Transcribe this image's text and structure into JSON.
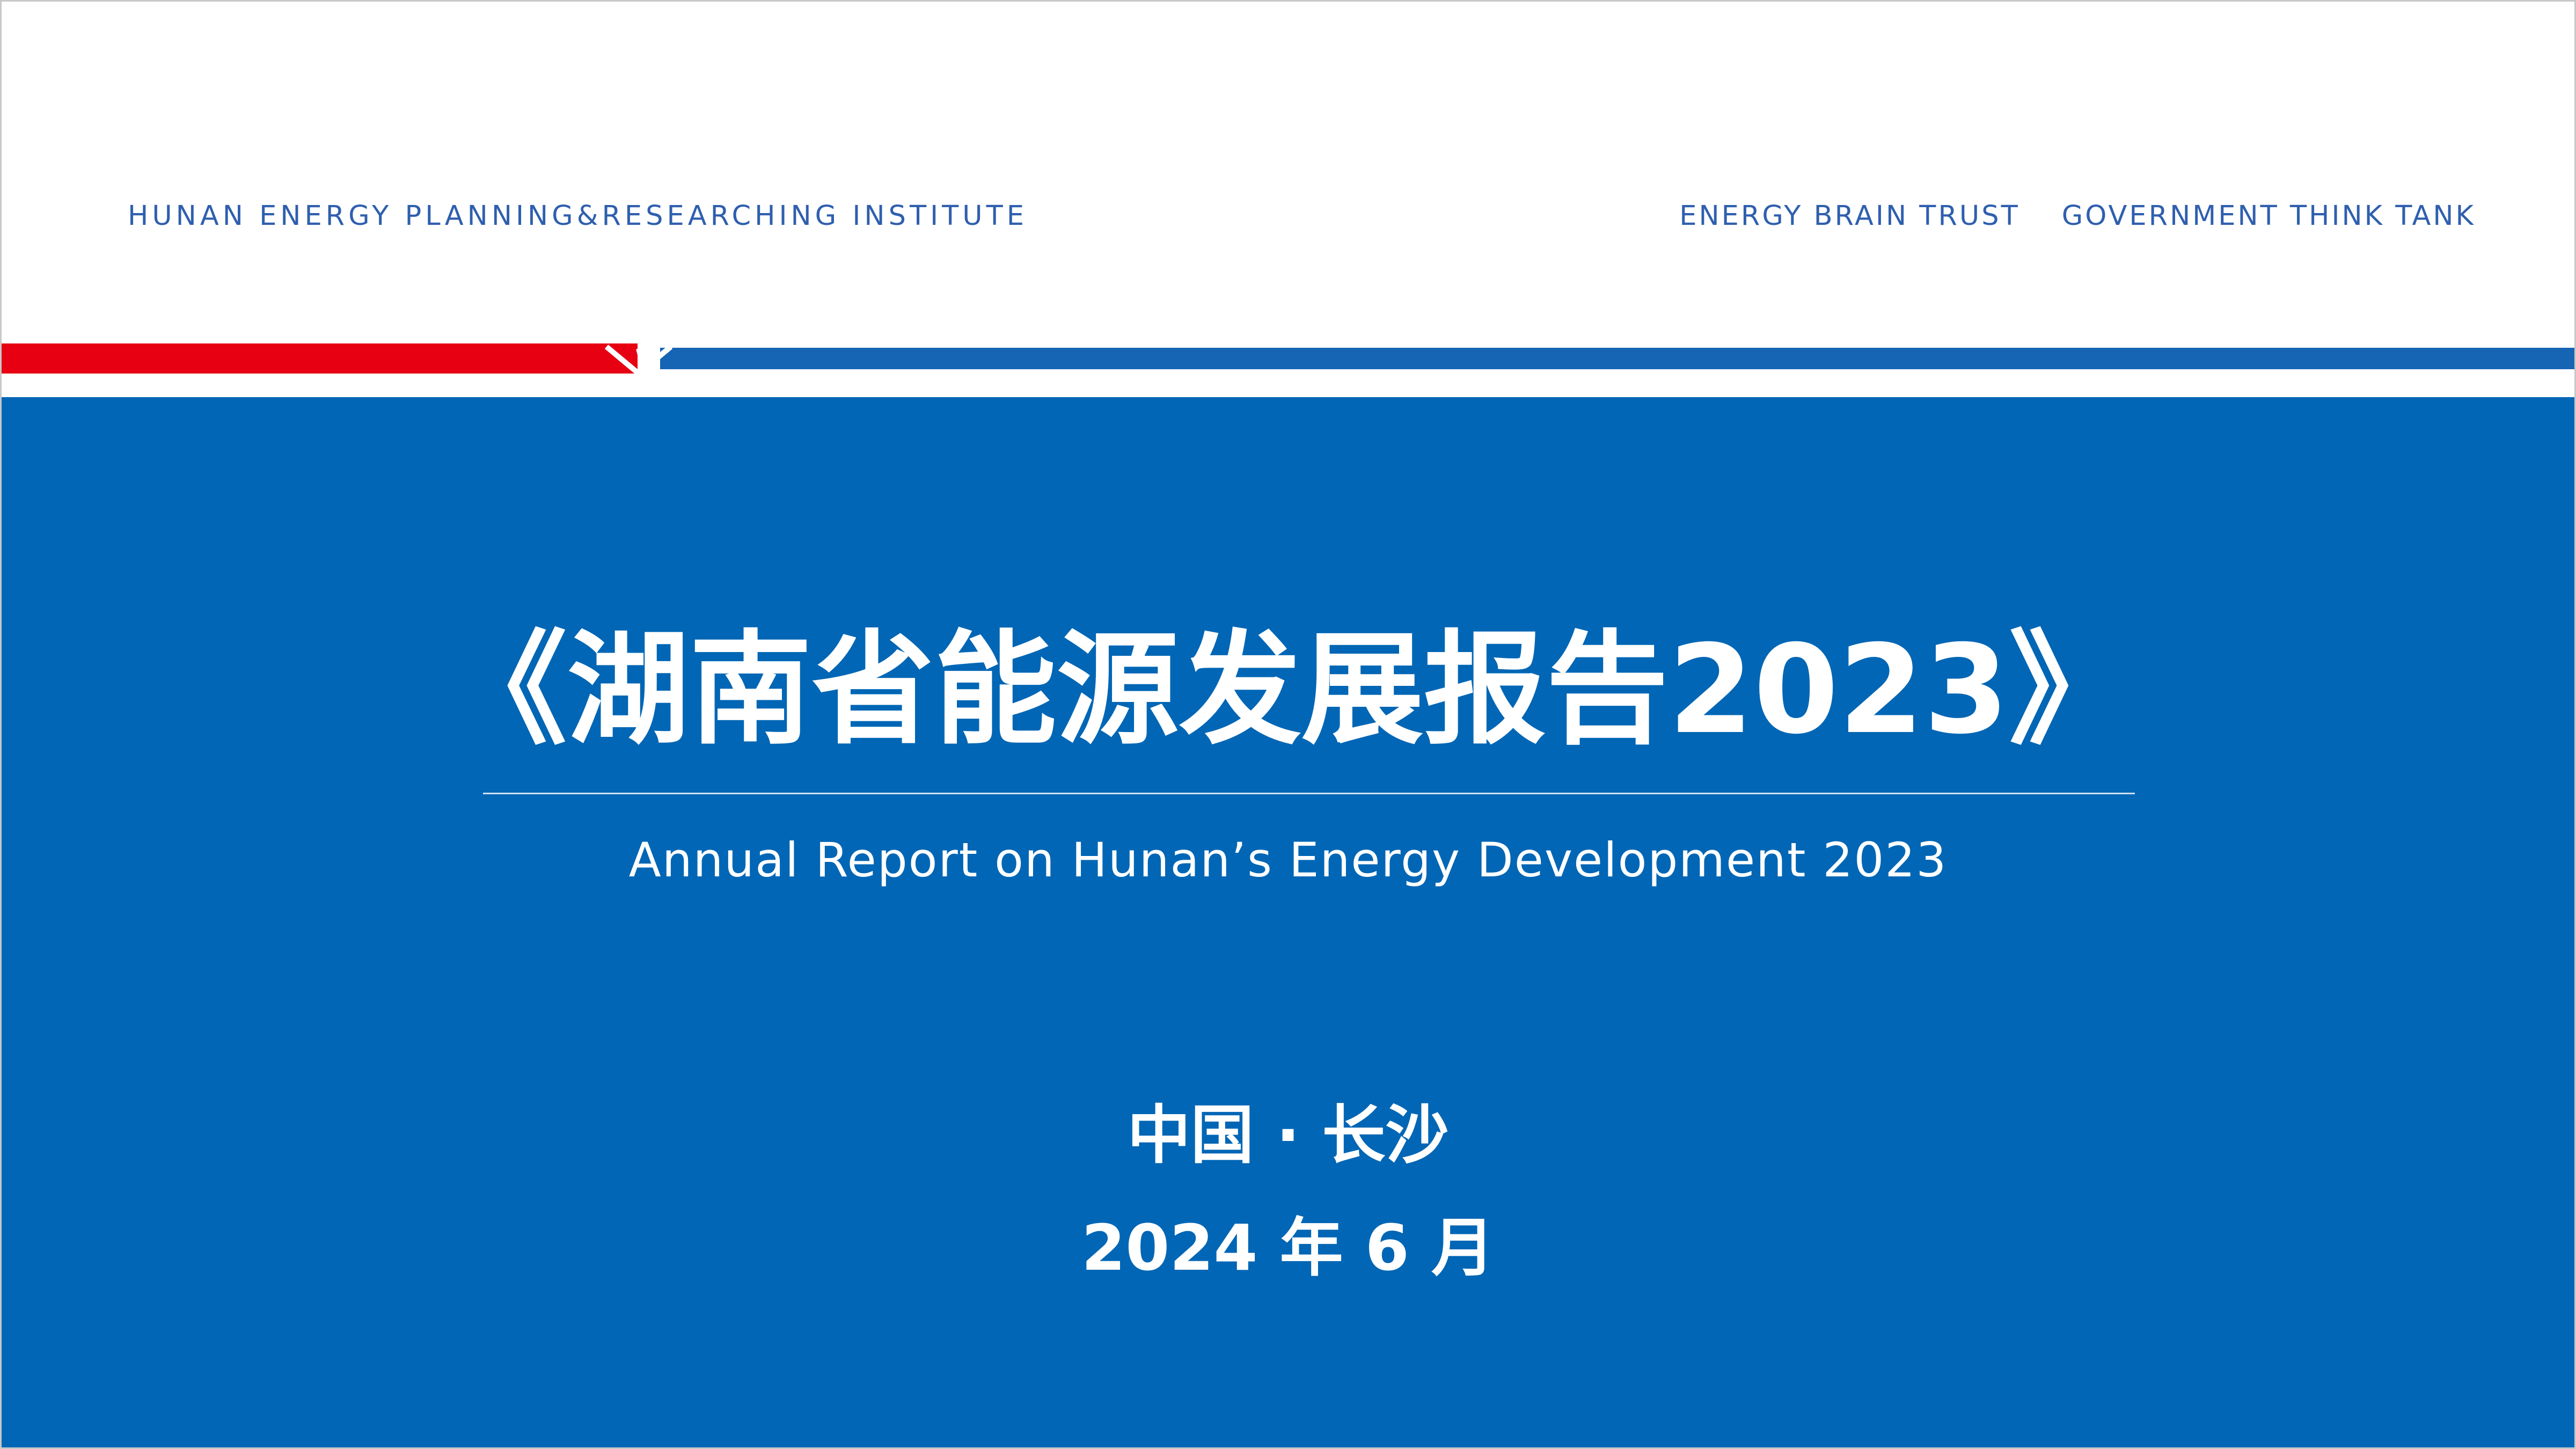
{
  "header": {
    "institute": "HUNAN ENERGY PLANNING&RESEARCHING INSTITUTE",
    "tag_1": "ENERGY BRAIN TRUST",
    "tag_2": "GOVERNMENT THINK TANK"
  },
  "cover": {
    "title_cn": "《湖南省能源发展报告2023》",
    "title_en": "Annual Report on Hunan’s Energy Development 2023",
    "location": "中国 · 长沙",
    "date": "2024 年 6 月"
  },
  "colors": {
    "primary_blue": "#0066b5",
    "accent_red": "#e60012",
    "header_text": "#2f5fae"
  }
}
